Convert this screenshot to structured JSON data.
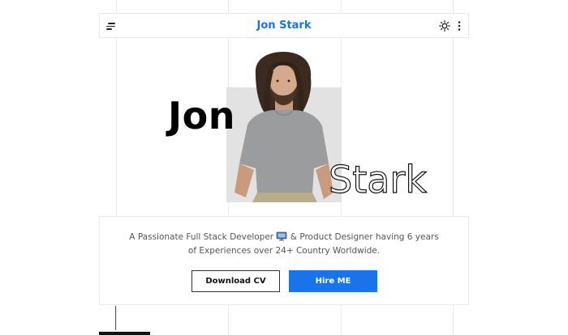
{
  "header": {
    "brand": "Jon Stark",
    "menu_icon": "menu-icon",
    "theme_icon": "sun-icon",
    "more_icon": "more-vertical-icon"
  },
  "hero": {
    "first_name": "Jon",
    "last_name": "Stark",
    "photo": "portrait-photo"
  },
  "intro": {
    "tagline_part1": "A Passionate Full Stack Developer",
    "tagline_icon": "monitor-icon",
    "tagline_part2": "& Product Designer having 6 years of Experiences over 24+ Country Worldwide.",
    "download_cv_label": "Download CV",
    "hire_me_label": "Hire ME"
  },
  "colors": {
    "accent": "#1a73e8",
    "text": "#222222",
    "photo_bg": "#e2e2e2"
  }
}
